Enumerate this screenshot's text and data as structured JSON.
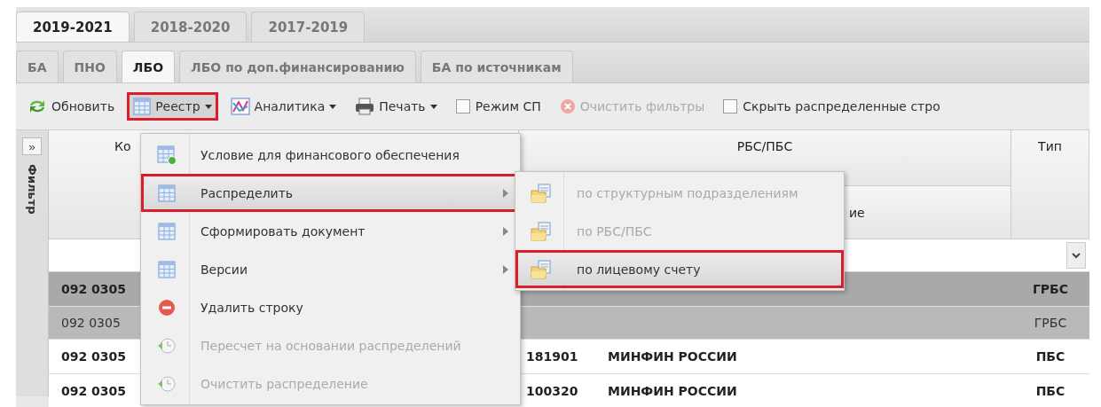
{
  "year_tabs": [
    {
      "label": "2019-2021",
      "selected": true
    },
    {
      "label": "2018-2020",
      "selected": false
    },
    {
      "label": "2017-2019",
      "selected": false
    }
  ],
  "section_tabs": [
    {
      "label": "БА",
      "selected": false
    },
    {
      "label": "ПНО",
      "selected": false
    },
    {
      "label": "ЛБО",
      "selected": true
    },
    {
      "label": "ЛБО по доп.финансированию",
      "selected": false
    },
    {
      "label": "БА по источникам",
      "selected": false
    }
  ],
  "toolbar": [
    {
      "kind": "button",
      "label": "Обновить",
      "disabled": false,
      "highlighted": false
    },
    {
      "kind": "menu-button",
      "label": "Реестр",
      "disabled": false,
      "highlighted": true
    },
    {
      "kind": "menu-button",
      "label": "Аналитика",
      "disabled": false,
      "highlighted": false
    },
    {
      "kind": "menu-button",
      "label": "Печать",
      "disabled": false,
      "highlighted": false
    },
    {
      "kind": "checkbox",
      "label": "Режим СП",
      "checked": false
    },
    {
      "kind": "button",
      "label": "Очистить фильтры",
      "disabled": true,
      "highlighted": false
    },
    {
      "kind": "checkbox",
      "label": "Скрыть распределенные стро",
      "checked": false
    }
  ],
  "filter_panel": {
    "toggle": "»",
    "label": "Фильтр"
  },
  "grid": {
    "header": {
      "code": "Ко",
      "group": "РБС/ПБС",
      "name": "ие",
      "type": "Тип"
    },
    "rows": [
      {
        "kind": "group",
        "code": "092 0305",
        "number": "",
        "name": "",
        "type": "ГРБС"
      },
      {
        "kind": "subgroup",
        "code": "092 0305",
        "number": "",
        "name": "",
        "type": "ГРБС"
      },
      {
        "kind": "item",
        "code": "092 0305",
        "number": "181901",
        "name": "МИНФИН РОССИИ",
        "type": "ПБС"
      },
      {
        "kind": "item",
        "code": "092 0305",
        "number": "100320",
        "name": "МИНФИН РОССИИ",
        "type": "ПБС"
      }
    ]
  },
  "menu": [
    {
      "label": "Условие для финансового обеспечения",
      "has_submenu": false,
      "disabled": false,
      "highlighted": false
    },
    {
      "label": "Распределить",
      "has_submenu": true,
      "disabled": false,
      "highlighted": true
    },
    {
      "label": "Сформировать документ",
      "has_submenu": true,
      "disabled": false,
      "highlighted": false
    },
    {
      "label": "Версии",
      "has_submenu": true,
      "disabled": false,
      "highlighted": false
    },
    {
      "label": "Удалить строку",
      "has_submenu": false,
      "disabled": false,
      "highlighted": false
    },
    {
      "label": "Пересчет на основании распределений",
      "has_submenu": false,
      "disabled": true,
      "highlighted": false
    },
    {
      "label": "Очистить распределение",
      "has_submenu": false,
      "disabled": true,
      "highlighted": false
    }
  ],
  "submenu": [
    {
      "label": "по структурным подразделениям",
      "disabled": true,
      "highlighted": false
    },
    {
      "label": "по РБС/ПБС",
      "disabled": true,
      "highlighted": false
    },
    {
      "label": "по лицевому счету",
      "disabled": false,
      "highlighted": true
    }
  ]
}
